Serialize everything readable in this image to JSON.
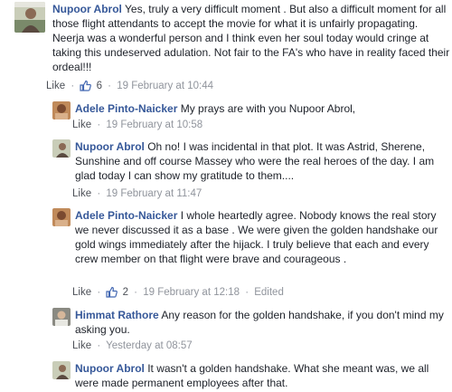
{
  "comments": [
    {
      "author": "Nupoor Abrol",
      "text": "Yes, truly a very difficult moment . But also a difficult moment for all those flight attendants to accept the movie for what it is unfairly propagating. Neerja was a wonderful person and I think even her soul today would cringe at taking this undeserved adulation. Not fair to the FA's who have in reality faced their ordeal!!!",
      "like_label": "Like",
      "reaction_count": "6",
      "timestamp": "19 February at 10:44"
    },
    {
      "author": "Adele Pinto-Naicker",
      "text": "My prays are with you Nupoor Abrol,",
      "like_label": "Like",
      "timestamp": "19 February at 10:58"
    },
    {
      "author": "Nupoor Abrol",
      "text": "Oh no! I was incidental in that plot. It was Astrid, Sherene, Sunshine and off course Massey who were the real heroes of the day. I am glad today I can show my gratitude to them....",
      "like_label": "Like",
      "timestamp": "19 February at 11:47"
    },
    {
      "author": "Adele Pinto-Naicker",
      "text": "I whole heartedly agree. Nobody knows the real story we never discussed it as a base . We were given the golden handshake our gold wings immediately after the hijack. I truly believe that each and every crew member on that flight were brave and courageous .",
      "like_label": "Like",
      "reaction_count": "2",
      "timestamp": "19 February at 12:18",
      "edited_label": "Edited"
    },
    {
      "author": "Himmat Rathore",
      "text": "Any reason for the golden handshake, if you don't mind my asking you.",
      "like_label": "Like",
      "timestamp": "Yesterday at 08:57"
    },
    {
      "author": "Nupoor Abrol",
      "text": "It wasn't a golden handshake. What she meant was, we all were made permanent employees after that."
    }
  ],
  "separator": "·",
  "colors": {
    "author": "#365899",
    "meta": "#90949c",
    "like_thumb": "#4267b2"
  }
}
